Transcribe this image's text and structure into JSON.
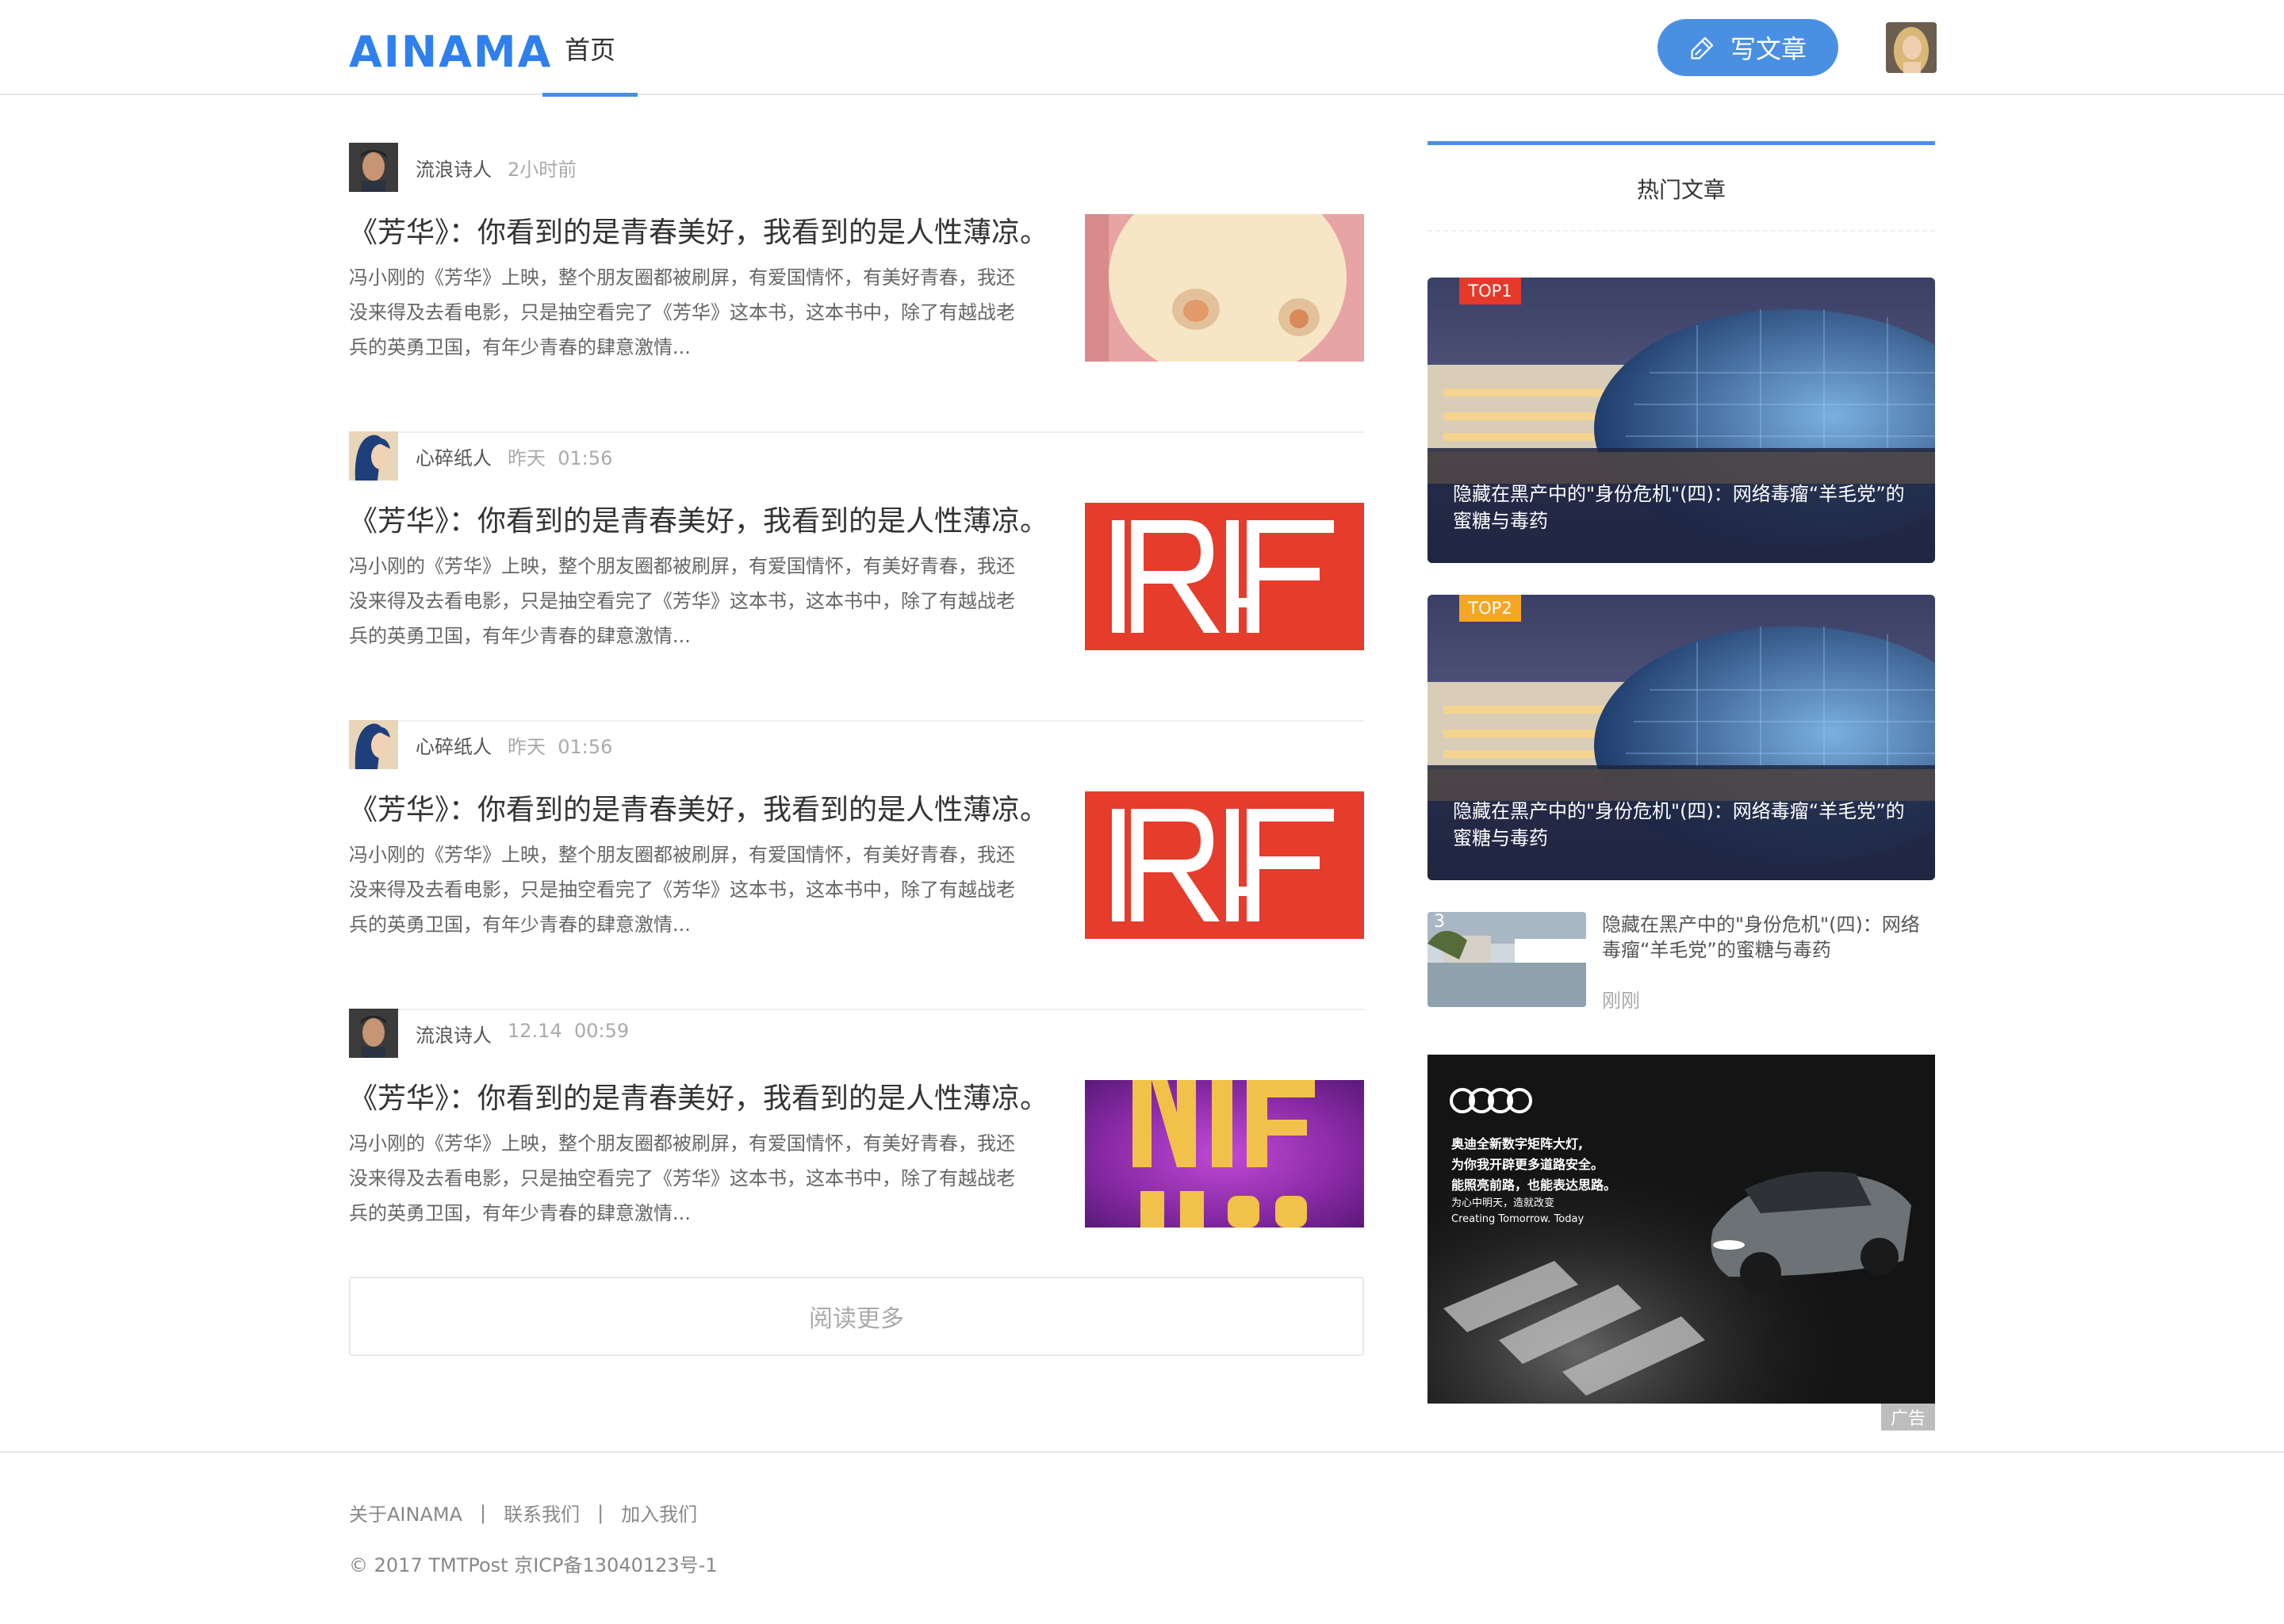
{
  "header": {
    "logo": "AINAMA",
    "nav_home": "首页",
    "write_button": "写文章",
    "brand_color": "#4a90e2"
  },
  "articles": [
    {
      "author": "流浪诗人",
      "time": "2小时前",
      "title": "《芳华》：你看到的是青春美好，我看到的是人性薄凉。",
      "summary": "冯小刚的《芳华》上映，整个朋友圈都被刷屏，有爱国情怀，有美好青春，我还没来得及去看电影，只是抽空看完了《芳华》这本书，这本书中，除了有越战老兵的英勇卫国，有年少青春的肆意激情..."
    },
    {
      "author": "心碎纸人",
      "time": "昨天  01:56",
      "title": "《芳华》：你看到的是青春美好，我看到的是人性薄凉。",
      "summary": "冯小刚的《芳华》上映，整个朋友圈都被刷屏，有爱国情怀，有美好青春，我还没来得及去看电影，只是抽空看完了《芳华》这本书，这本书中，除了有越战老兵的英勇卫国，有年少青春的肆意激情..."
    },
    {
      "author": "心碎纸人",
      "time": "昨天  01:56",
      "title": "《芳华》：你看到的是青春美好，我看到的是人性薄凉。",
      "summary": "冯小刚的《芳华》上映，整个朋友圈都被刷屏，有爱国情怀，有美好青春，我还没来得及去看电影，只是抽空看完了《芳华》这本书，这本书中，除了有越战老兵的英勇卫国，有年少青春的肆意激情..."
    },
    {
      "author": "流浪诗人",
      "time": "12.14  00:59",
      "title": "《芳华》：你看到的是青春美好，我看到的是人性薄凉。",
      "summary": "冯小刚的《芳华》上映，整个朋友圈都被刷屏，有爱国情怀，有美好青春，我还没来得及去看电影，只是抽空看完了《芳华》这本书，这本书中，除了有越战老兵的英勇卫国，有年少青春的肆意激情..."
    }
  ],
  "load_more": "阅读更多",
  "sidebar": {
    "hot_title": "热门文章",
    "cards": [
      {
        "badge": "TOP1",
        "badge_color": "#e5392b",
        "title": "隐藏在黑产中的\"身份危机\"(四)：网络毒瘤“羊毛党”的蜜糖与毒药"
      },
      {
        "badge": "TOP2",
        "badge_color": "#f5a623",
        "title": "隐藏在黑产中的\"身份危机\"(四)：网络毒瘤“羊毛党”的蜜糖与毒药"
      }
    ],
    "small_item": {
      "rank": "3",
      "title": "隐藏在黑产中的\"身份危机\"(四)：网络毒瘤“羊毛党”的蜜糖与毒药",
      "time": "刚刚"
    },
    "ad": {
      "line1": "奥迪全新数字矩阵大灯,",
      "line2": "为你我开辟更多道路安全。",
      "line3": "能照亮前路，也能表达思路。",
      "line4": "为心中明天，造就改变",
      "line5": "Creating Tomorrow. Today",
      "label": "广告"
    }
  },
  "footer": {
    "links": [
      "关于AINAMA",
      "联系我们",
      "加入我们"
    ],
    "separator": "|",
    "copyright": "© 2017 TMTPost 京ICP备13040123号-1"
  }
}
